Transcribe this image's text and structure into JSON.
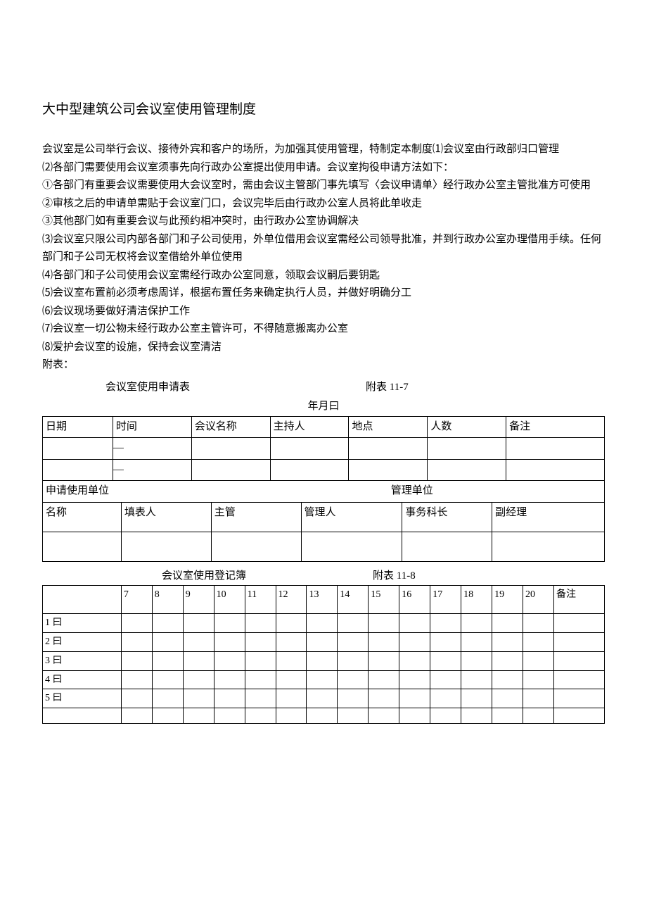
{
  "title": "大中型建筑公司会议室使用管理制度",
  "paragraphs": {
    "p1": "会议室是公司举行会议、接待外宾和客户的场所，为加强其使用管理，特制定本制度⑴会议室由行政部归口管理",
    "p2": "⑵各部门需要使用会议室须事先向行政办公室提出使用申请。会议室拘役申请方法如下：",
    "p3": "①各部门有重要会议需要使用大会议室时，需由会议主管部门事先填写〈会议申请单〉经行政办公室主管批准方可使用",
    "p4": "②审核之后的申请单需贴于会议室门口，会议完毕后由行政办公室人员将此单收走",
    "p5": "③其他部门如有重要会议与此预约相冲突时，由行政办公室协调解决",
    "p6": "⑶会议室只限公司内部各部门和子公司使用，外单位借用会议室需经公司领导批准，并到行政办公室办理借用手续。任何部门和子公司无权将会议室借给外单位使用",
    "p7": "⑷各部门和子公司使用会议室需经行政办公室同意，领取会议嗣后要钥匙",
    "p8": "⑸会议室布置前必须考虑周详，根据布置任务来确定执行人员，并做好明确分工",
    "p9": "⑹会议现场要做好清洁保护工作",
    "p10": "⑺会议室一切公物未经行政办公室主管许可，不得随意搬离办公室",
    "p11": "⑻爱护会议室的设施，保持会议室清洁",
    "p12": "附表："
  },
  "table1": {
    "title": "会议室使用申请表",
    "ref": "附表 11-7",
    "ymd": "年月曰",
    "headers": {
      "c1": "日期",
      "c2": "时间",
      "c3": "会议名称",
      "c4": "主持人",
      "c5": "地点",
      "c6": "人数",
      "c7": "备注"
    },
    "dash": "—",
    "sub": {
      "apply": "申请使用单位",
      "mgmt": "管理单位"
    },
    "row2": {
      "c1": "名称",
      "c2": "填表人",
      "c3": "主管",
      "c4": "管理人",
      "c5": "事务科长",
      "c6": "副经理"
    }
  },
  "table2": {
    "title": "会议室使用登记簿",
    "ref": "附表 11-8",
    "cols": {
      "c7": "7",
      "c8": "8",
      "c9": "9",
      "c10": "10",
      "c11": "11",
      "c12": "12",
      "c13": "13",
      "c14": "14",
      "c15": "15",
      "c16": "16",
      "c17": "17",
      "c18": "18",
      "c19": "19",
      "c20": "20",
      "note": "备注"
    },
    "rows": {
      "r1": "1 曰",
      "r2": "2 曰",
      "r3": "3 曰",
      "r4": "4 曰",
      "r5": "5 曰"
    }
  }
}
